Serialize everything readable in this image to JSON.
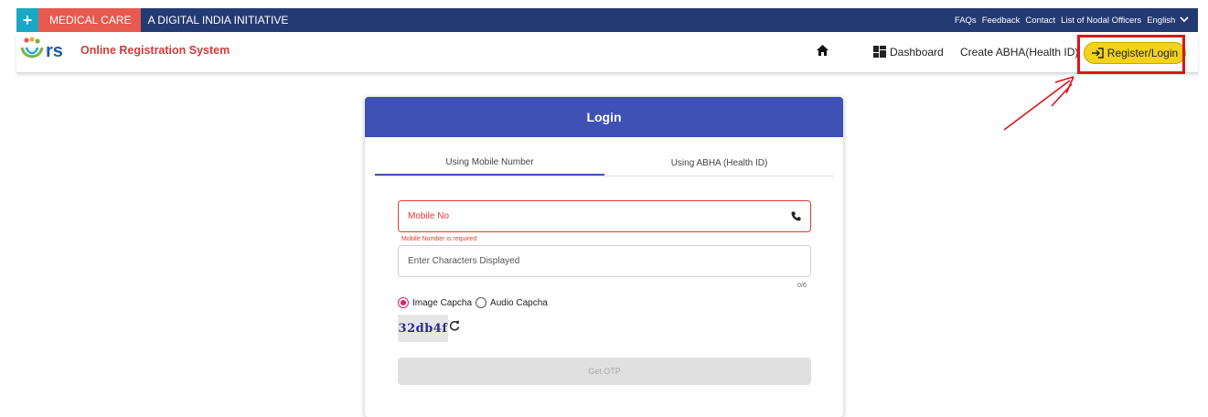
{
  "topbar": {
    "plus": "+",
    "brand": "MEDICAL CARE",
    "initiative": "A DIGITAL INDIA INITIATIVE",
    "links": [
      "FAQs",
      "Feedback",
      "Contact",
      "List of Nodal Officers",
      "English"
    ]
  },
  "header": {
    "logo_text": "rs",
    "system_name": "Online Registration System",
    "nav": {
      "dashboard": "Dashboard",
      "abha": "Create ABHA(Health ID)",
      "register_login": "Register/Login"
    }
  },
  "login": {
    "title": "Login",
    "tabs": [
      "Using Mobile Number",
      "Using ABHA (Health ID)"
    ],
    "active_tab": 0,
    "mobile_placeholder": "Mobile No",
    "mobile_error": "Mobile Number is required",
    "captcha_placeholder": "Enter Characters Displayed",
    "captcha_counter": "0/6",
    "radio_image": "Image Capcha",
    "radio_audio": "Audio Capcha",
    "selected_radio": "Image Capcha",
    "captcha_code": "32db4f",
    "otp_button": "Get OTP"
  },
  "colors": {
    "topbar": "#243a73",
    "brand_red": "#e8594f",
    "accent_teal": "#1aa9c5",
    "card_header": "#3f51b5",
    "register_button": "#f2d21c",
    "error": "#e53935",
    "annotation": "#e0121a"
  }
}
